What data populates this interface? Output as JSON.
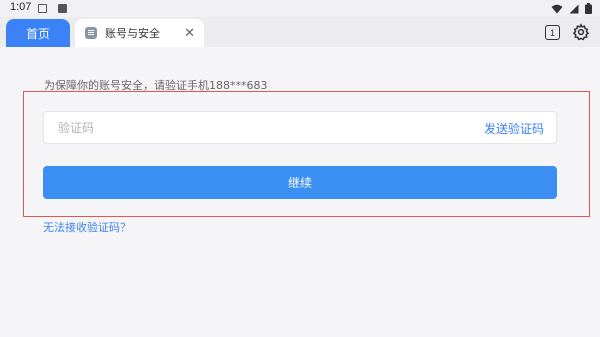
{
  "status_bar": {
    "time": "1:07"
  },
  "tabs": {
    "home_label": "首页",
    "account_label": "账号与安全",
    "close_symbol": "✕",
    "count": "1"
  },
  "form": {
    "notice": "为保障你的账号安全，请验证手机188***683",
    "code_placeholder": "验证码",
    "code_value": "",
    "send_code_label": "发送验证码",
    "continue_label": "继续",
    "cant_receive_label": "无法接收验证码？"
  },
  "colors": {
    "accent": "#3b82f6",
    "button": "#3b8ff3",
    "highlight": "#e05555"
  }
}
